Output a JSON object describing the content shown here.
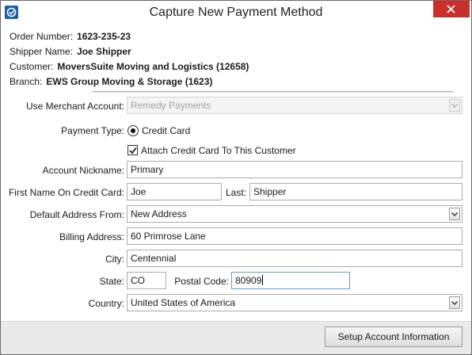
{
  "window": {
    "title": "Capture New Payment Method",
    "accent_color": "#c9302c"
  },
  "order": {
    "order_number_label": "Order Number:",
    "order_number": "1623-235-23",
    "shipper_label": "Shipper Name:",
    "shipper": "Joe Shipper",
    "customer_label": "Customer:",
    "customer": "MoversSuite Moving and Logistics (12658)",
    "branch_label": "Branch:",
    "branch": "EWS Group Moving & Storage (1623)"
  },
  "form": {
    "merchant_label": "Use Merchant Account:",
    "merchant_value": "Remedy Payments",
    "payment_type_label": "Payment Type:",
    "payment_type_option": "Credit Card",
    "payment_type_selected": true,
    "attach_label": "Attach Credit Card To This Customer",
    "attach_checked": true,
    "nickname_label": "Account Nickname:",
    "nickname": "Primary",
    "first_name_label": "First Name On Credit Card:",
    "first_name": "Joe",
    "last_label": "Last:",
    "last_name": "Shipper",
    "default_address_label": "Default Address From:",
    "default_address": "New Address",
    "billing_label": "Billing Address:",
    "billing": "60 Primrose Lane",
    "city_label": "City:",
    "city": "Centennial",
    "state_label": "State:",
    "state": "CO",
    "postal_label": "Postal Code:",
    "postal": "80909",
    "country_label": "Country:",
    "country": "United States of America"
  },
  "footer": {
    "setup_button": "Setup Account Information"
  }
}
